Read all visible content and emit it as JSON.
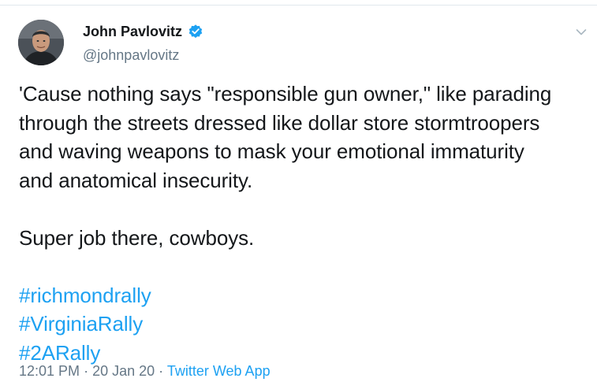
{
  "author": {
    "display_name": "John Pavlovitz",
    "handle": "@johnpavlovitz",
    "verified": true,
    "avatar_icon": "avatar-photo"
  },
  "tweet": {
    "lines": [
      "'Cause nothing says \"responsible gun owner,\" like parading",
      "through the streets dressed like dollar store stormtroopers",
      "and waving weapons to mask your emotional immaturity",
      "and anatomical insecurity."
    ],
    "second_paragraph": "Super job there, cowboys.",
    "hashtags": [
      "#richmondrally",
      "#VirginiaRally",
      "#2ARally"
    ]
  },
  "meta": {
    "time": "12:01 PM",
    "date": "20 Jan 20",
    "separator": "·",
    "source": "Twitter Web App"
  },
  "colors": {
    "link": "#1da1f2",
    "secondary_text": "#657786",
    "primary_text": "#14171a",
    "verified_badge": "#1da1f2"
  },
  "icons": {
    "verified": "verified-badge-icon",
    "more": "chevron-down-icon"
  }
}
